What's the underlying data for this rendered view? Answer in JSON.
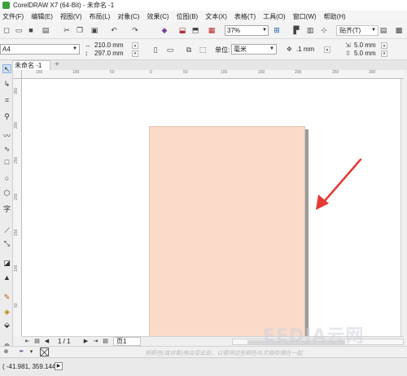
{
  "window": {
    "title": "CorelDRAW X7 (64-Bit) - 未命名 -1"
  },
  "menu": [
    "文件(F)",
    "编辑(E)",
    "视图(V)",
    "布局(L)",
    "对象(C)",
    "效果(C)",
    "位图(B)",
    "文本(X)",
    "表格(T)",
    "工具(O)",
    "窗口(W)",
    "帮助(H)"
  ],
  "toolbar": {
    "zoom": "37%",
    "snap_label": "贴齐(T)",
    "icons": [
      "new-icon",
      "open-icon",
      "save-icon",
      "print-icon",
      "cut-icon",
      "copy-icon",
      "paste-icon",
      "undo-icon",
      "redo-icon",
      "search-content-icon",
      "import-icon",
      "export-icon",
      "publish-pdf-icon",
      "zoom-level-icon",
      "full-screen-icon",
      "rulers-icon",
      "grid-icon",
      "guidelines-icon",
      "options-icon",
      "app-launcher-icon"
    ]
  },
  "propbar": {
    "page_size": "A4",
    "width": "210.0 mm",
    "height": "297.0 mm",
    "unit_label": "单位:",
    "unit": "毫米",
    "nudge": ".1 mm",
    "dup_x": "5.0 mm",
    "dup_y": "5.0 mm"
  },
  "tab": {
    "doc_name": "未命名 -1",
    "add": "+"
  },
  "ruler": {
    "h_ticks": [
      "150",
      "100",
      "50",
      "0",
      "50",
      "100",
      "150",
      "200",
      "250",
      "300"
    ],
    "v_ticks": [
      "350",
      "300",
      "250",
      "200",
      "150",
      "100",
      "50",
      "0"
    ],
    "unit": "毫米"
  },
  "navigator": {
    "count": "1 / 1",
    "page_tab": "页1"
  },
  "hint": "将颜色(或对象)拖动至此处，以便将这些颜色与文档存储在一起",
  "status": {
    "coords": "( -41.981, 359.144 )"
  },
  "watermark": "EEDJA云网",
  "colors": {
    "page": "#fadbca",
    "arrow": "#e53935"
  }
}
